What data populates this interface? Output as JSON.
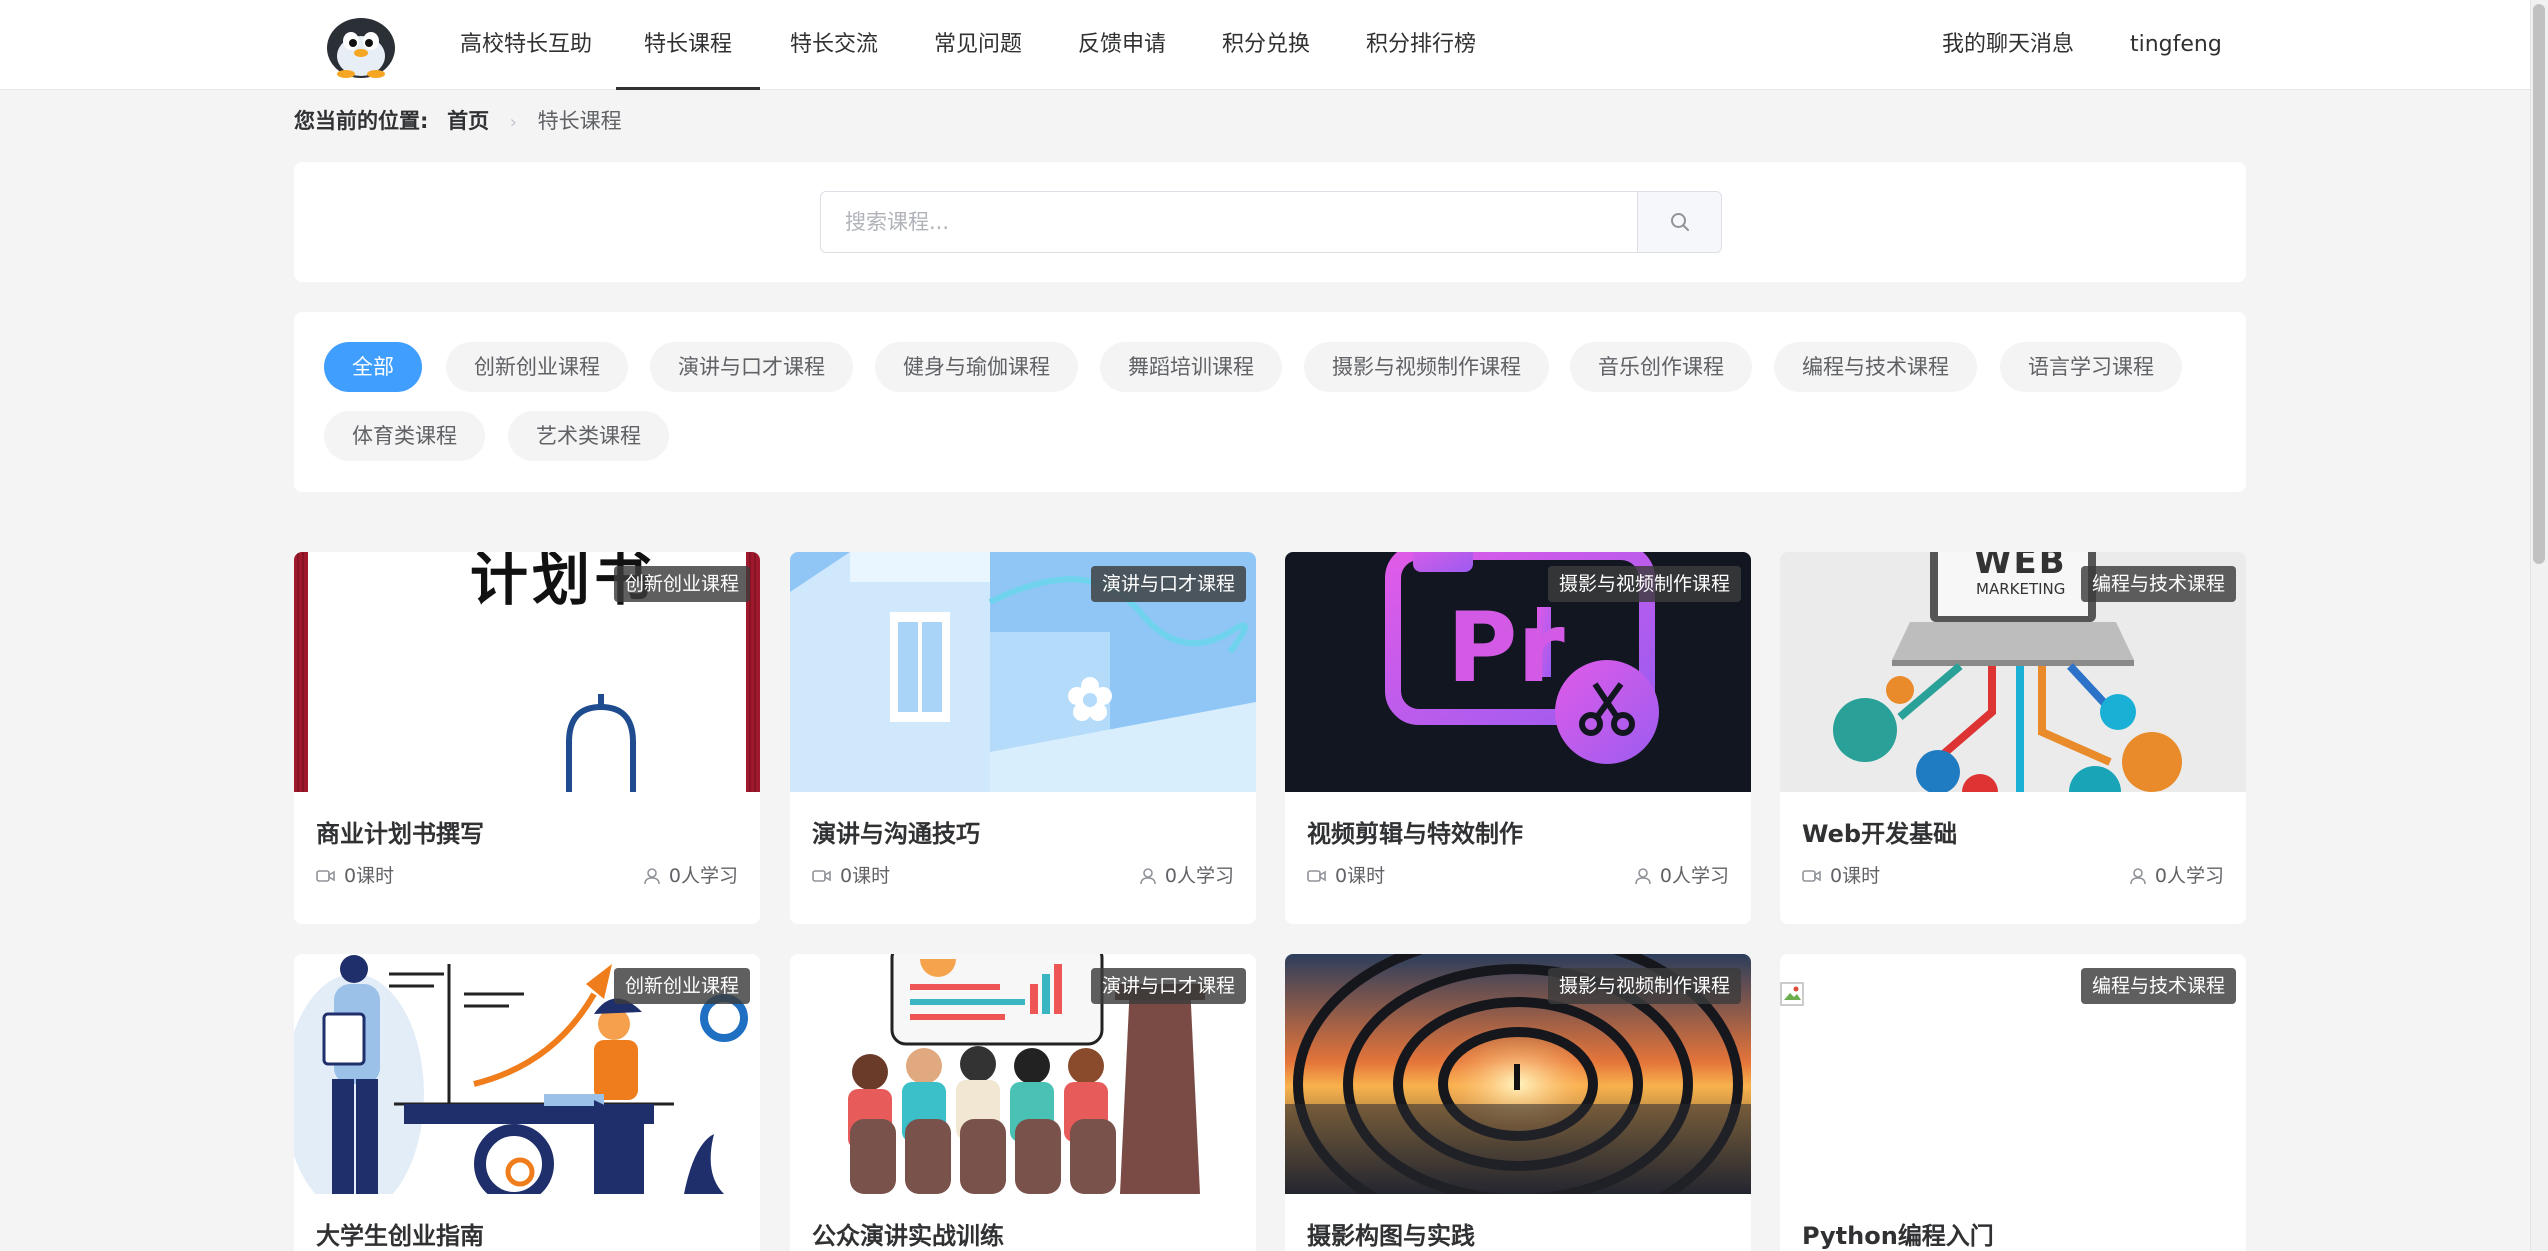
{
  "nav": {
    "items": [
      {
        "label": "高校特长互助"
      },
      {
        "label": "特长课程"
      },
      {
        "label": "特长交流"
      },
      {
        "label": "常见问题"
      },
      {
        "label": "反馈申请"
      },
      {
        "label": "积分兑换"
      },
      {
        "label": "积分排行榜"
      }
    ],
    "active_index": 1,
    "messages": "我的聊天消息",
    "username": "tingfeng"
  },
  "breadcrumb": {
    "label": "您当前的位置:",
    "home": "首页",
    "current": "特长课程"
  },
  "search": {
    "placeholder": "搜索课程...",
    "value": ""
  },
  "categories": [
    "全部",
    "创新创业课程",
    "演讲与口才课程",
    "健身与瑜伽课程",
    "舞蹈培训课程",
    "摄影与视频制作课程",
    "音乐创作课程",
    "编程与技术课程",
    "语言学习课程",
    "体育类课程",
    "艺术类课程"
  ],
  "active_category": "全部",
  "courses": [
    {
      "title": "商业计划书撰写",
      "category": "创新创业课程",
      "lessons": "0课时",
      "learners": "0人学习",
      "thumb_text": "计划书"
    },
    {
      "title": "演讲与沟通技巧",
      "category": "演讲与口才课程",
      "lessons": "0课时",
      "learners": "0人学习"
    },
    {
      "title": "视频剪辑与特效制作",
      "category": "摄影与视频制作课程",
      "lessons": "0课时",
      "learners": "0人学习",
      "thumb_text": "Pr"
    },
    {
      "title": "Web开发基础",
      "category": "编程与技术课程",
      "lessons": "0课时",
      "learners": "0人学习",
      "thumb_text": "WEB",
      "thumb_sub": "MARKETING"
    },
    {
      "title": "大学生创业指南",
      "category": "创新创业课程"
    },
    {
      "title": "公众演讲实战训练",
      "category": "演讲与口才课程"
    },
    {
      "title": "摄影构图与实践",
      "category": "摄影与视频制作课程"
    },
    {
      "title": "Python编程入门",
      "category": "编程与技术课程"
    }
  ],
  "colors": {
    "accent": "#409eff",
    "nav_active_underline": "#303133",
    "chip_bg": "#f4f4f5",
    "page_bg": "#f4f4f5"
  }
}
